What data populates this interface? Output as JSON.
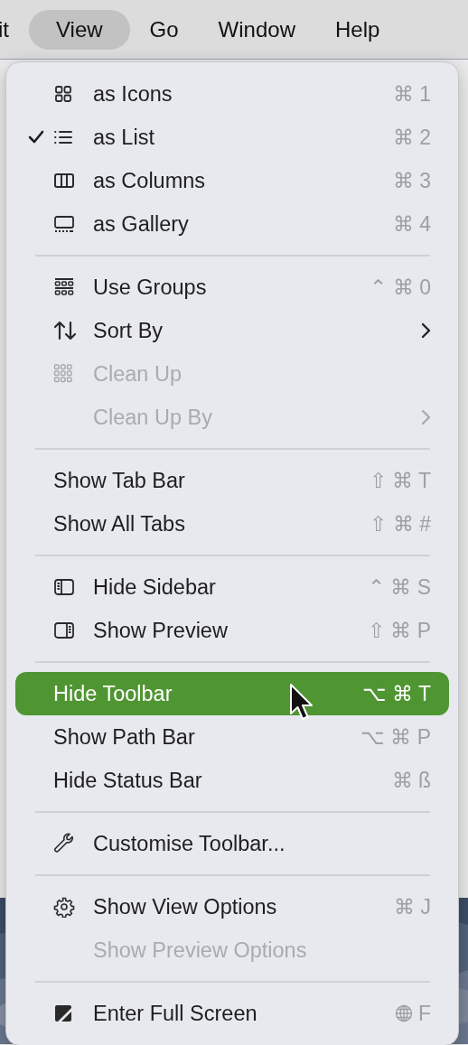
{
  "menu_bar": {
    "items": [
      {
        "label": "it",
        "selected": false
      },
      {
        "label": "View",
        "selected": true
      },
      {
        "label": "Go",
        "selected": false
      },
      {
        "label": "Window",
        "selected": false
      },
      {
        "label": "Help",
        "selected": false
      }
    ]
  },
  "view_menu": {
    "entries": [
      {
        "kind": "item",
        "label": "as Icons",
        "shortcut": "⌘ 1",
        "checked": false,
        "disabled": false,
        "selected": false,
        "submenu": false
      },
      {
        "kind": "item",
        "label": "as List",
        "shortcut": "⌘ 2",
        "checked": true,
        "disabled": false,
        "selected": false,
        "submenu": false
      },
      {
        "kind": "item",
        "label": "as Columns",
        "shortcut": "⌘ 3",
        "checked": false,
        "disabled": false,
        "selected": false,
        "submenu": false
      },
      {
        "kind": "item",
        "label": "as Gallery",
        "shortcut": "⌘ 4",
        "checked": false,
        "disabled": false,
        "selected": false,
        "submenu": false
      },
      {
        "kind": "separator"
      },
      {
        "kind": "item",
        "label": "Use Groups",
        "shortcut": "⌃ ⌘ 0",
        "checked": false,
        "disabled": false,
        "selected": false,
        "submenu": false
      },
      {
        "kind": "item",
        "label": "Sort By",
        "checked": false,
        "disabled": false,
        "selected": false,
        "submenu": true
      },
      {
        "kind": "item",
        "label": "Clean Up",
        "checked": false,
        "disabled": true,
        "selected": false,
        "submenu": false
      },
      {
        "kind": "item",
        "label": "Clean Up By",
        "checked": false,
        "disabled": true,
        "selected": false,
        "submenu": true
      },
      {
        "kind": "separator"
      },
      {
        "kind": "item",
        "label": "Show Tab Bar",
        "shortcut": "⇧ ⌘ T",
        "checked": false,
        "disabled": false,
        "selected": false,
        "submenu": false
      },
      {
        "kind": "item",
        "label": "Show All Tabs",
        "shortcut": "⇧ ⌘ #",
        "checked": false,
        "disabled": false,
        "selected": false,
        "submenu": false
      },
      {
        "kind": "separator"
      },
      {
        "kind": "item",
        "label": "Hide Sidebar",
        "shortcut": "⌃ ⌘ S",
        "checked": false,
        "disabled": false,
        "selected": false,
        "submenu": false
      },
      {
        "kind": "item",
        "label": "Show Preview",
        "shortcut": "⇧ ⌘ P",
        "checked": false,
        "disabled": false,
        "selected": false,
        "submenu": false
      },
      {
        "kind": "separator"
      },
      {
        "kind": "item",
        "label": "Hide Toolbar",
        "shortcut": "⌥ ⌘ T",
        "checked": false,
        "disabled": false,
        "selected": true,
        "submenu": false
      },
      {
        "kind": "item",
        "label": "Show Path Bar",
        "shortcut": "⌥ ⌘ P",
        "checked": false,
        "disabled": false,
        "selected": false,
        "submenu": false
      },
      {
        "kind": "item",
        "label": "Hide Status Bar",
        "shortcut": "⌘ ß",
        "checked": false,
        "disabled": false,
        "selected": false,
        "submenu": false
      },
      {
        "kind": "separator"
      },
      {
        "kind": "item",
        "label": "Customise Toolbar...",
        "checked": false,
        "disabled": false,
        "selected": false,
        "submenu": false
      },
      {
        "kind": "separator"
      },
      {
        "kind": "item",
        "label": "Show View Options",
        "shortcut": "⌘ J",
        "checked": false,
        "disabled": false,
        "selected": false,
        "submenu": false
      },
      {
        "kind": "item",
        "label": "Show Preview Options",
        "checked": false,
        "disabled": true,
        "selected": false,
        "submenu": false
      },
      {
        "kind": "separator"
      },
      {
        "kind": "item",
        "label": "Enter Full Screen",
        "shortcut": "F",
        "checked": false,
        "disabled": false,
        "selected": false,
        "submenu": false
      }
    ]
  }
}
